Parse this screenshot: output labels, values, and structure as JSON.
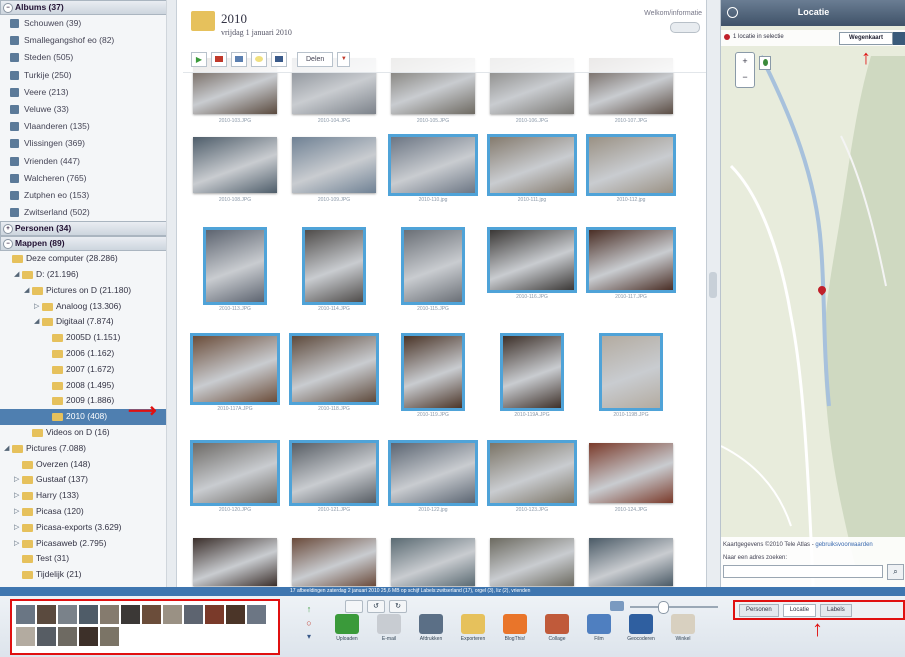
{
  "sidebar": {
    "albums_header": "Albums (37)",
    "albums": [
      "Schouwen (39)",
      "Smallegangshof eo (82)",
      "Steden (505)",
      "Turkije (250)",
      "Veere (213)",
      "Veluwe (33)",
      "Vlaanderen (135)",
      "Vlissingen (369)",
      "Vrienden (447)",
      "Walcheren (765)",
      "Zutphen eo (153)",
      "Zwitserland (502)"
    ],
    "personen_header": "Personen (34)",
    "mappen_header": "Mappen (89)",
    "folders": [
      {
        "label": "Deze computer (28.286)",
        "indent": 0,
        "arrow": ""
      },
      {
        "label": "D: (21.196)",
        "indent": 1,
        "arrow": "◢"
      },
      {
        "label": "Pictures on D (21.180)",
        "indent": 2,
        "arrow": "◢"
      },
      {
        "label": "Analoog (13.306)",
        "indent": 3,
        "arrow": "▷"
      },
      {
        "label": "Digitaal (7.874)",
        "indent": 3,
        "arrow": "◢"
      },
      {
        "label": "2005D (1.151)",
        "indent": 4,
        "arrow": ""
      },
      {
        "label": "2006 (1.162)",
        "indent": 4,
        "arrow": ""
      },
      {
        "label": "2007 (1.672)",
        "indent": 4,
        "arrow": ""
      },
      {
        "label": "2008 (1.495)",
        "indent": 4,
        "arrow": ""
      },
      {
        "label": "2009 (1.886)",
        "indent": 4,
        "arrow": ""
      },
      {
        "label": "2010 (408)",
        "indent": 4,
        "arrow": "",
        "selected": true
      },
      {
        "label": "Videos on D (16)",
        "indent": 2,
        "arrow": ""
      },
      {
        "label": "Pictures (7.088)",
        "indent": 0,
        "arrow": "◢"
      },
      {
        "label": "Overzen (148)",
        "indent": 1,
        "arrow": ""
      },
      {
        "label": "Gustaaf (137)",
        "indent": 1,
        "arrow": "▷"
      },
      {
        "label": "Harry (133)",
        "indent": 1,
        "arrow": "▷"
      },
      {
        "label": "Picasa (120)",
        "indent": 1,
        "arrow": "▷"
      },
      {
        "label": "Picasa-exports (3.629)",
        "indent": 1,
        "arrow": "▷"
      },
      {
        "label": "Picasaweb (2.795)",
        "indent": 1,
        "arrow": "▷"
      },
      {
        "label": "Test (31)",
        "indent": 1,
        "arrow": ""
      },
      {
        "label": "Tijdelijk (21)",
        "indent": 1,
        "arrow": ""
      }
    ]
  },
  "header": {
    "title": "2010",
    "date": "vrijdag 1 januari 2010",
    "info_link": "Welkom/informatie",
    "share_button": "Delen"
  },
  "photos": {
    "rows": [
      [
        {
          "caption": "2010-103.JPG",
          "color": "#5a4a3e"
        },
        {
          "caption": "2010-104.JPG",
          "color": "#7c828a"
        },
        {
          "caption": "2010-105.JPG",
          "color": "#6e6a62"
        },
        {
          "caption": "2010-106.JPG",
          "color": "#7a7874"
        },
        {
          "caption": "2010-107.JPG",
          "color": "#5b4d44"
        }
      ],
      [
        {
          "caption": "2010-108.JPG",
          "color": "#4e5d6a"
        },
        {
          "caption": "2010-109.JPG",
          "color": "#6f8194"
        },
        {
          "caption": "2010-110.jpg",
          "color": "#6c7684",
          "sel": true
        },
        {
          "caption": "2010-111.jpg",
          "color": "#857b6e",
          "sel": true
        },
        {
          "caption": "2010-112.jpg",
          "color": "#9a9184",
          "sel": true
        }
      ],
      [
        {
          "caption": "2010-113.JPG",
          "color": "#5d6470",
          "sel": true
        },
        {
          "caption": "2010-114.JPG",
          "color": "#4f4c4a",
          "sel": true
        },
        {
          "caption": "2010-115.JPG",
          "color": "#6a6f76",
          "sel": true
        },
        {
          "caption": "2010-116.JPG",
          "color": "#3b3836",
          "sel": true
        },
        {
          "caption": "2010-117.JPG",
          "color": "#4a2e25",
          "sel": true
        }
      ],
      [
        {
          "caption": "2010-117A.JPG",
          "color": "#6b4d3a",
          "sel": true
        },
        {
          "caption": "2010-118.JPG",
          "color": "#5e4a3c",
          "sel": true
        },
        {
          "caption": "2010-119.JPG",
          "color": "#4b3528",
          "sel": true
        },
        {
          "caption": "2010-119A.JPG",
          "color": "#3d3029",
          "sel": true
        },
        {
          "caption": "2010-119B.JPG",
          "color": "#b3aba0",
          "sel": true
        }
      ],
      [
        {
          "caption": "2010-120.JPG",
          "color": "#6d6a66",
          "sel": true
        },
        {
          "caption": "2010-121.JPG",
          "color": "#575d64",
          "sel": true
        },
        {
          "caption": "2010-122.jpg",
          "color": "#5b6572",
          "sel": true
        },
        {
          "caption": "2010-123.JPG",
          "color": "#7b7466",
          "sel": true
        },
        {
          "caption": "2010-124.JPG",
          "color": "#7a3a2a"
        }
      ],
      [
        {
          "caption": "",
          "color": "#3a2e2a"
        },
        {
          "caption": "",
          "color": "#6a4a3a"
        },
        {
          "caption": "",
          "color": "#5a6a72"
        },
        {
          "caption": "",
          "color": "#6c6a60"
        },
        {
          "caption": "",
          "color": "#4a5a66"
        }
      ]
    ]
  },
  "map": {
    "title": "Locatie",
    "selection_info": "1 locatie in selectie",
    "map_type": "Wegenkaart",
    "copyright": "Kaartgegevens ©2010 Tele Atlas -",
    "terms_link": "gebruiksvoorwaarden",
    "search_label": "Naar een adres zoeken:",
    "search_value": ""
  },
  "status": {
    "text": "17 afbeeldingen   zaterdag 2 januari 2010   25,6 MB op schijf   Labels:zwitserland (17), orgel (3), liz (2), vrienden"
  },
  "bottom": {
    "tools": [
      "Uploaden",
      "E-mail",
      "Afdrukken",
      "Exporteren",
      "BlogThis!",
      "Collage",
      "Film",
      "Geocoderen",
      "Winkel"
    ],
    "tabs": [
      "Personen",
      "Locatie",
      "Labels"
    ]
  },
  "colors": {
    "selection_blue": "#4fa3d8",
    "annotation_red": "#e01010",
    "status_bar": "#3f76b0",
    "map_water": "#a7c1dc",
    "map_land": "#e8ecdc"
  },
  "icons": {
    "album": "album-icon",
    "folder": "folder-icon",
    "pin": "map-pin-icon"
  }
}
